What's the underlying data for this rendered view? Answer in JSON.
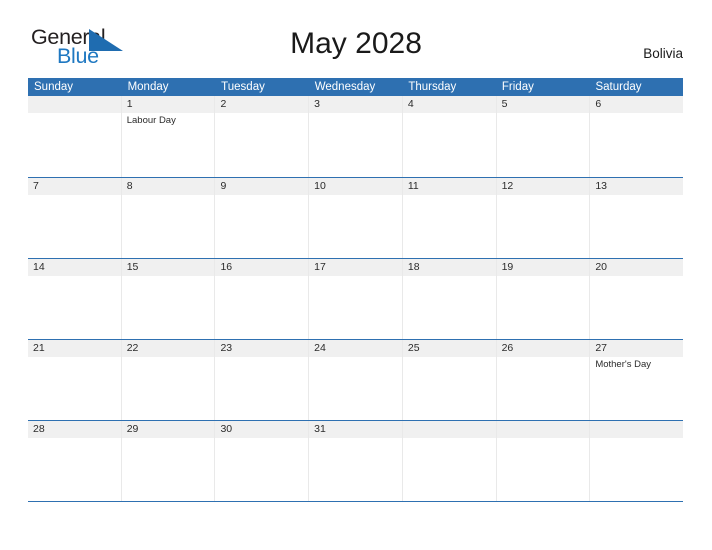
{
  "brand": {
    "name_part1": "General",
    "name_part2": "Blue",
    "triangle_icon": "triangle-icon",
    "colors": {
      "dark": "#231f20",
      "blue": "#1f78c1"
    }
  },
  "header": {
    "title": "May 2028",
    "country": "Bolivia"
  },
  "theme": {
    "header_blue": "#2e70b1",
    "date_band_gray": "#f0f0f0",
    "page_background": "#ffffff",
    "text": "#1a1a1a"
  },
  "calendar": {
    "weekdays": [
      "Sunday",
      "Monday",
      "Tuesday",
      "Wednesday",
      "Thursday",
      "Friday",
      "Saturday"
    ],
    "weeks": [
      [
        {
          "day": "",
          "events": []
        },
        {
          "day": "1",
          "events": [
            "Labour Day"
          ]
        },
        {
          "day": "2",
          "events": []
        },
        {
          "day": "3",
          "events": []
        },
        {
          "day": "4",
          "events": []
        },
        {
          "day": "5",
          "events": []
        },
        {
          "day": "6",
          "events": []
        }
      ],
      [
        {
          "day": "7",
          "events": []
        },
        {
          "day": "8",
          "events": []
        },
        {
          "day": "9",
          "events": []
        },
        {
          "day": "10",
          "events": []
        },
        {
          "day": "11",
          "events": []
        },
        {
          "day": "12",
          "events": []
        },
        {
          "day": "13",
          "events": []
        }
      ],
      [
        {
          "day": "14",
          "events": []
        },
        {
          "day": "15",
          "events": []
        },
        {
          "day": "16",
          "events": []
        },
        {
          "day": "17",
          "events": []
        },
        {
          "day": "18",
          "events": []
        },
        {
          "day": "19",
          "events": []
        },
        {
          "day": "20",
          "events": []
        }
      ],
      [
        {
          "day": "21",
          "events": []
        },
        {
          "day": "22",
          "events": []
        },
        {
          "day": "23",
          "events": []
        },
        {
          "day": "24",
          "events": []
        },
        {
          "day": "25",
          "events": []
        },
        {
          "day": "26",
          "events": []
        },
        {
          "day": "27",
          "events": [
            "Mother's Day"
          ]
        }
      ],
      [
        {
          "day": "28",
          "events": []
        },
        {
          "day": "29",
          "events": []
        },
        {
          "day": "30",
          "events": []
        },
        {
          "day": "31",
          "events": []
        },
        {
          "day": "",
          "events": []
        },
        {
          "day": "",
          "events": []
        },
        {
          "day": "",
          "events": []
        }
      ]
    ]
  }
}
